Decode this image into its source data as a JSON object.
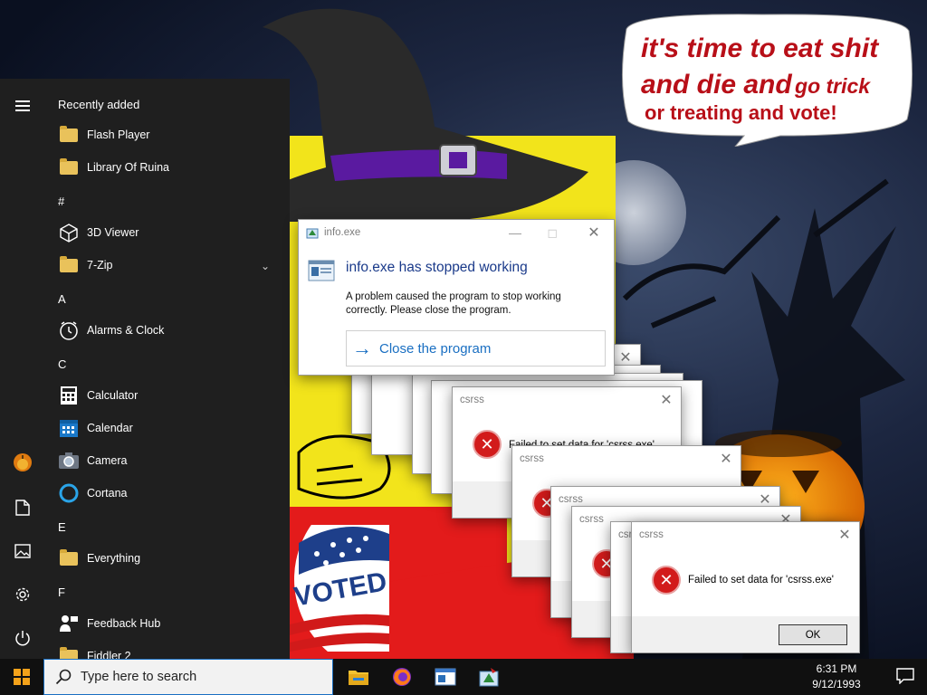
{
  "wallpaper": {
    "speech_line1": "it's time to eat shit",
    "speech_line2_big": "and die and",
    "speech_line2_small": "go trick",
    "speech_line3": "or treating and vote!",
    "badge_text": "VOTED"
  },
  "start_menu": {
    "header": "Recently added",
    "sections": [
      {
        "letter": "",
        "items": [
          {
            "label": "Flash Player",
            "icon": "folder-icon"
          },
          {
            "label": "Library Of Ruina",
            "icon": "folder-icon"
          }
        ]
      },
      {
        "letter": "#",
        "items": [
          {
            "label": "3D Viewer",
            "icon": "cube-icon"
          },
          {
            "label": "7-Zip",
            "icon": "folder-icon",
            "expandable": true
          }
        ]
      },
      {
        "letter": "A",
        "items": [
          {
            "label": "Alarms & Clock",
            "icon": "clock-icon"
          }
        ]
      },
      {
        "letter": "C",
        "items": [
          {
            "label": "Calculator",
            "icon": "calculator-icon"
          },
          {
            "label": "Calendar",
            "icon": "calendar-icon"
          },
          {
            "label": "Camera",
            "icon": "camera-icon"
          },
          {
            "label": "Cortana",
            "icon": "cortana-icon"
          }
        ]
      },
      {
        "letter": "E",
        "items": [
          {
            "label": "Everything",
            "icon": "folder-icon"
          }
        ]
      },
      {
        "letter": "F",
        "items": [
          {
            "label": "Feedback Hub",
            "icon": "feedback-icon"
          },
          {
            "label": "Fiddler 2",
            "icon": "folder-icon"
          }
        ]
      }
    ],
    "rail": [
      "menu-icon",
      "user-avatar-icon",
      "documents-icon",
      "pictures-icon",
      "settings-icon",
      "power-icon"
    ]
  },
  "info_dialog": {
    "title": "info.exe",
    "heading": "info.exe has stopped working",
    "body": "A problem caused the program to stop working correctly. Please close the program.",
    "action": "Close the program"
  },
  "error_dialogs": {
    "title": "csrss",
    "message": "Failed to set data for 'csrss.exe'",
    "message_partial": "Failed to set data for 'csrss.exe'",
    "ok_label": "OK",
    "partial_title": "csr"
  },
  "taskbar": {
    "search_placeholder": "Type here to search",
    "apps": [
      "file-explorer-icon",
      "firefox-icon",
      "window-icon",
      "installer-icon"
    ],
    "time": "6:31 PM",
    "date": "9/12/1993"
  }
}
